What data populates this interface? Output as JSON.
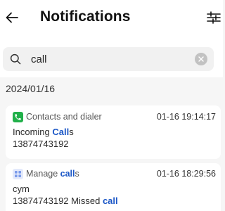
{
  "header": {
    "title": "Notifications"
  },
  "search": {
    "value": "call",
    "placeholder": ""
  },
  "group": {
    "date": "2024/01/16"
  },
  "notifications": [
    {
      "app": "Contacts and dialer",
      "app_icon": "phone-icon",
      "app_icon_color": "#21b04a",
      "time": "01-16 19:14:17",
      "line1_prefix": "Incoming ",
      "line1_match": "Call",
      "line1_suffix": "s",
      "line2": "13874743192"
    },
    {
      "app_prefix": "Manage ",
      "app_match": "call",
      "app_suffix": "s",
      "app_icon": "grid-icon",
      "app_icon_color": "#7b9bea",
      "time": "01-16 18:29:56",
      "line1": "cym",
      "line2_prefix": "13874743192 Missed ",
      "line2_match": "call"
    }
  ],
  "colors": {
    "highlight": "#1a56c6",
    "background": "#f6f6f6",
    "card": "#ffffff"
  }
}
